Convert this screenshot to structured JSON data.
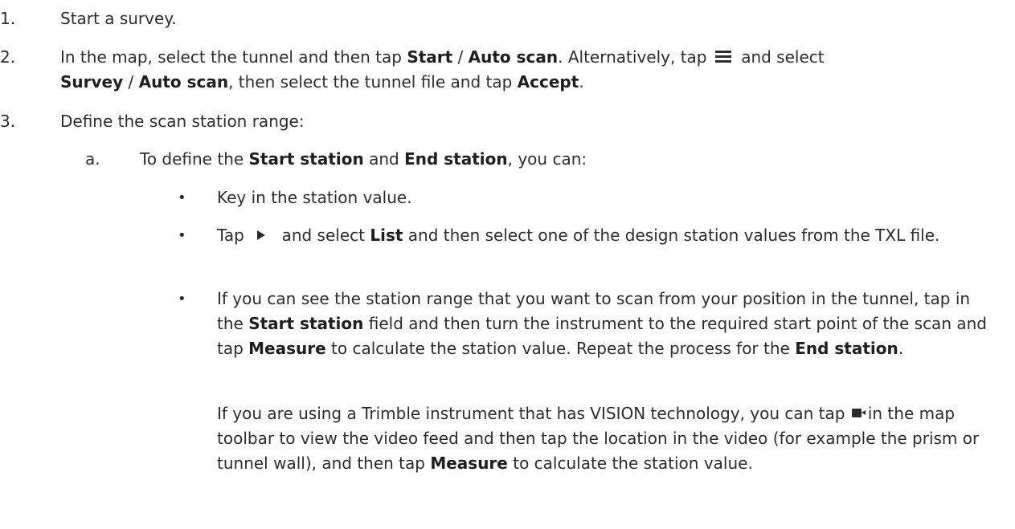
{
  "steps": [
    {
      "num": "1.",
      "text": "Start a survey."
    },
    {
      "num": "2.",
      "parts": {
        "a": "In the map, select the tunnel and then tap ",
        "b": "Start",
        "c": " / ",
        "d": "Auto scan",
        "e": ". Alternatively, tap ",
        "f": " and select ",
        "g": "Survey",
        "h": " / ",
        "i": "Auto scan",
        "j": ", then select the tunnel file and tap ",
        "k": "Accept",
        "l": "."
      },
      "icon": "menu-icon"
    },
    {
      "num": "3.",
      "text": "Define the scan station range:"
    }
  ],
  "substep_a": {
    "num": "a.",
    "parts": {
      "a": "To define the ",
      "b": "Start station",
      "c": " and ",
      "d": "End station",
      "e": ", you can:"
    }
  },
  "bullets": [
    {
      "marker": "•",
      "text": "Key in the station value."
    },
    {
      "marker": "•",
      "parts": {
        "a": "Tap ",
        "b": " and select ",
        "c": "List",
        "d": " and then select one of the design station values from the TXL file."
      },
      "icon": "triangle-right-icon"
    },
    {
      "marker": "•",
      "parts": {
        "a": "If you can see the station range that you want to scan from your position in the tunnel, tap in the ",
        "b": "Start station",
        "c": " field and then turn the instrument to the required start point of the scan and tap ",
        "d": "Measure",
        "e": " to calculate the station value. Repeat the process for the ",
        "f": "End station",
        "g": "."
      }
    }
  ],
  "vision_note": {
    "parts": {
      "a": "If you are using a Trimble instrument that has VISION technology, you can tap ",
      "b": "in the map toolbar to view the video feed and then tap the location in the video (for example the prism or tunnel wall), and then tap ",
      "c": "Measure",
      "d": " to calculate the station value."
    },
    "icon": "video-camera-icon"
  }
}
